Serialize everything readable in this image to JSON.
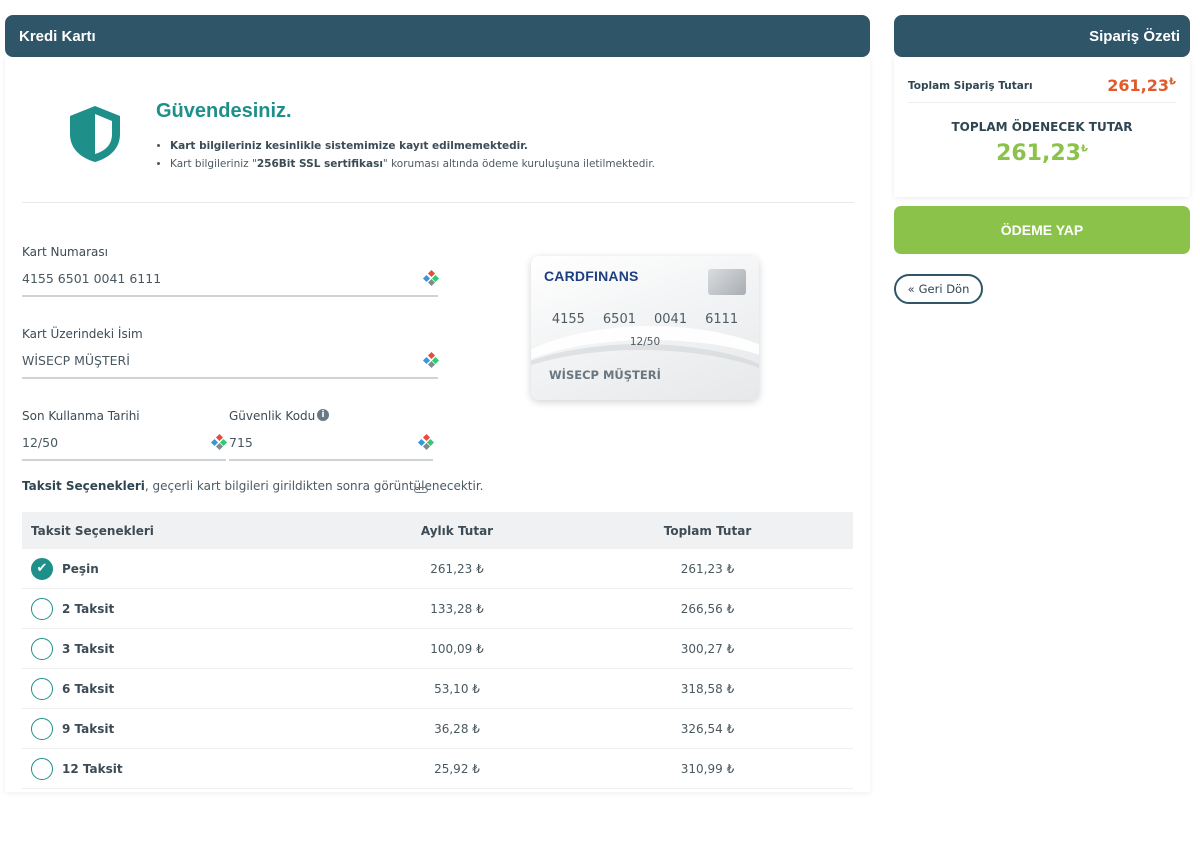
{
  "header": {
    "left_title": "Kredi Kartı",
    "right_title": "Sipariş Özeti"
  },
  "secure": {
    "title": "Güvendesiniz.",
    "line1": "Kart bilgileriniz kesinlikle sistemimize kayıt edilmemektedir.",
    "line2_prefix": "Kart bilgileriniz \"",
    "line2_bold": "256Bit SSL sertifikası",
    "line2_suffix": "\" koruması altında ödeme kuruluşuna iletilmektedir."
  },
  "form": {
    "card_number_label": "Kart Numarası",
    "card_number_value": "4155 6501 0041 6111",
    "name_label": "Kart Üzerindeki İsim",
    "name_value": "WİSECP MÜŞTERİ",
    "expiry_label": "Son Kullanma Tarihi",
    "expiry_value": "12/50",
    "cvv_label": "Güvenlik Kodu",
    "cvv_value": "715",
    "cvv_info": "i"
  },
  "card_preview": {
    "brand": "CARDFINANS",
    "number_groups": [
      "4155",
      "6501",
      "0041",
      "6111"
    ],
    "expiry": "12/50",
    "name": "WİSECP MÜŞTERİ"
  },
  "installment_note": {
    "bold": "Taksit Seçenekleri",
    "rest": ", geçerli kart bilgileri girildikten sonra görüntülenecektir."
  },
  "table": {
    "headers": [
      "Taksit Seçenekleri",
      "Aylık Tutar",
      "Toplam Tutar"
    ],
    "rows": [
      {
        "label": "Peşin",
        "monthly": "261,23 ₺",
        "total": "261,23 ₺",
        "selected": true
      },
      {
        "label": "2 Taksit",
        "monthly": "133,28 ₺",
        "total": "266,56 ₺",
        "selected": false
      },
      {
        "label": "3 Taksit",
        "monthly": "100,09 ₺",
        "total": "300,27 ₺",
        "selected": false
      },
      {
        "label": "6 Taksit",
        "monthly": "53,10 ₺",
        "total": "318,58 ₺",
        "selected": false
      },
      {
        "label": "9 Taksit",
        "monthly": "36,28 ₺",
        "total": "326,54 ₺",
        "selected": false
      },
      {
        "label": "12 Taksit",
        "monthly": "25,92 ₺",
        "total": "310,99 ₺",
        "selected": false
      }
    ]
  },
  "summary": {
    "order_total_label": "Toplam Sipariş Tutarı",
    "order_total_value": "261,23",
    "currency": "₺",
    "payable_label": "TOPLAM ÖDENECEK TUTAR",
    "payable_value": "261,23"
  },
  "actions": {
    "pay_label": "ÖDEME YAP",
    "back_label": "Geri Dön",
    "back_icon": "«"
  },
  "colors": {
    "header": "#2f5668",
    "accent": "#1f8f8a",
    "pay": "#8bc34a",
    "price": "#e05a2b"
  }
}
